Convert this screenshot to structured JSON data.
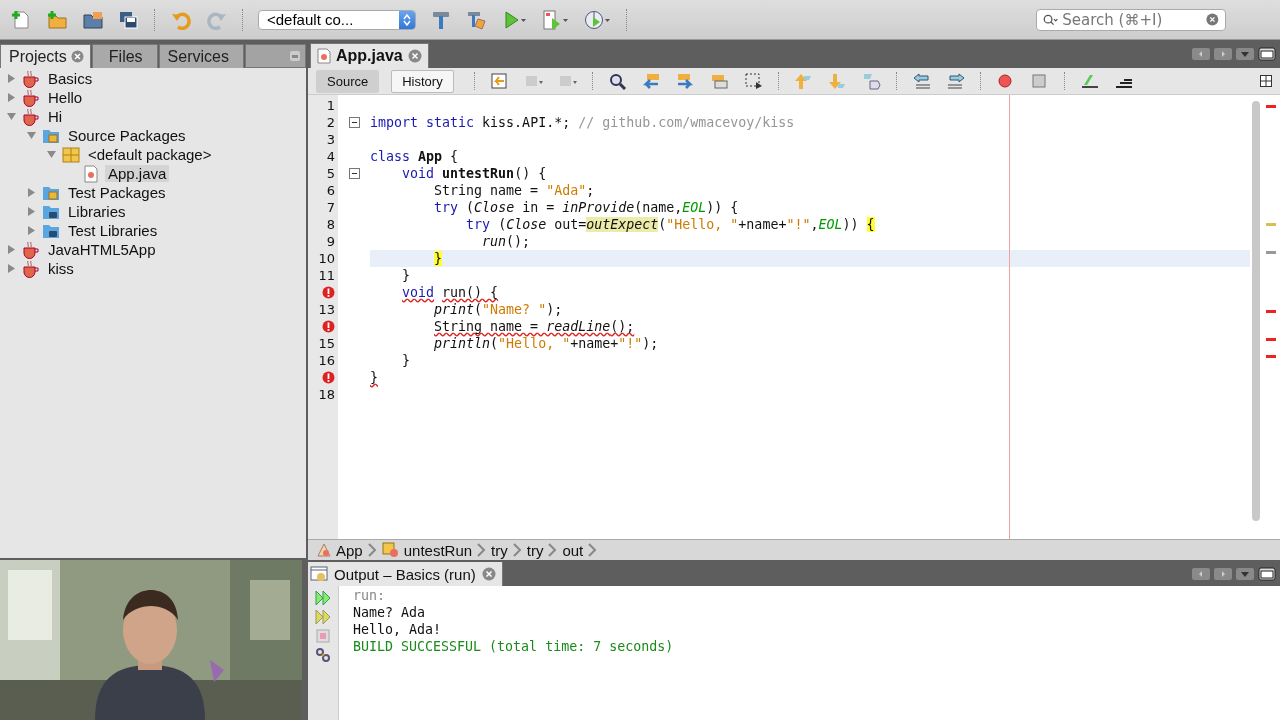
{
  "toolbar": {
    "config": {
      "value": "<default co..."
    },
    "search": {
      "placeholder": "Search (⌘+I)"
    }
  },
  "projects_panel": {
    "tabs": [
      {
        "label": "Projects",
        "selected": true,
        "closable": true
      },
      {
        "label": "Files",
        "selected": false,
        "closable": false
      },
      {
        "label": "Services",
        "selected": false,
        "closable": false
      }
    ],
    "tree": [
      {
        "label": "Basics",
        "kind": "project",
        "expanded": false,
        "selected": false
      },
      {
        "label": "Hello",
        "kind": "project",
        "expanded": false,
        "selected": false
      },
      {
        "label": "Hi",
        "kind": "project",
        "expanded": true,
        "selected": false,
        "children": [
          {
            "label": "Source Packages",
            "kind": "source-folder",
            "expanded": true,
            "selected": false,
            "children": [
              {
                "label": "<default package>",
                "kind": "package",
                "expanded": true,
                "selected": false,
                "children": [
                  {
                    "label": "App.java",
                    "kind": "file",
                    "selected": true
                  }
                ]
              }
            ]
          },
          {
            "label": "Test Packages",
            "kind": "source-folder",
            "expanded": false,
            "selected": false
          },
          {
            "label": "Libraries",
            "kind": "library-folder",
            "expanded": false,
            "selected": false
          },
          {
            "label": "Test Libraries",
            "kind": "library-folder",
            "expanded": false,
            "selected": false
          }
        ]
      },
      {
        "label": "JavaHTML5App",
        "kind": "project",
        "expanded": false,
        "selected": false
      },
      {
        "label": "kiss",
        "kind": "project",
        "expanded": false,
        "selected": false
      }
    ]
  },
  "editor": {
    "tabs": [
      {
        "label": "App.java",
        "selected": true
      }
    ],
    "views": [
      {
        "label": "Source",
        "selected": true
      },
      {
        "label": "History",
        "selected": false
      }
    ],
    "lines": [
      {
        "number": "1",
        "error": false,
        "fold": false,
        "current": false
      },
      {
        "number": "2",
        "error": false,
        "fold": true,
        "current": false,
        "tokens": [
          {
            "kind": "kw",
            "text": "import static"
          },
          {
            "kind": "plain",
            "text": " kiss.API.*; "
          },
          {
            "kind": "comment",
            "text": "// github.com/wmacevoy/kiss"
          }
        ]
      },
      {
        "number": "3",
        "error": false,
        "fold": false,
        "current": false
      },
      {
        "number": "4",
        "error": false,
        "fold": false,
        "current": false,
        "tokens": [
          {
            "kind": "kw",
            "text": "class"
          },
          {
            "kind": "bold",
            "text": " App"
          },
          {
            "kind": "plain",
            "text": " {"
          }
        ]
      },
      {
        "number": "5",
        "error": false,
        "fold": true,
        "current": false,
        "tokens": [
          {
            "kind": "kw",
            "text": "    void"
          },
          {
            "kind": "bold",
            "text": " untestRun"
          },
          {
            "kind": "plain",
            "text": "() {"
          }
        ]
      },
      {
        "number": "6",
        "error": false,
        "fold": false,
        "current": false,
        "tokens": [
          {
            "kind": "plain",
            "text": "        String name = "
          },
          {
            "kind": "str",
            "text": "\"Ada\""
          },
          {
            "kind": "plain",
            "text": ";"
          }
        ]
      },
      {
        "number": "7",
        "error": false,
        "fold": false,
        "current": false,
        "tokens": [
          {
            "kind": "kw",
            "text": "        try"
          },
          {
            "kind": "plain",
            "text": " ("
          },
          {
            "kind": "call",
            "text": "Close"
          },
          {
            "kind": "plain",
            "text": " in = "
          },
          {
            "kind": "call",
            "text": "inProvide"
          },
          {
            "kind": "plain",
            "text": "(name,"
          },
          {
            "kind": "const",
            "text": "EOL"
          },
          {
            "kind": "plain",
            "text": ")) {"
          }
        ]
      },
      {
        "number": "8",
        "error": false,
        "fold": false,
        "current": false,
        "tokens": [
          {
            "kind": "kw",
            "text": "            try"
          },
          {
            "kind": "plain",
            "text": " ("
          },
          {
            "kind": "call",
            "text": "Close"
          },
          {
            "kind": "plain",
            "text": " out="
          },
          {
            "kind": "hl",
            "text": "outExpect"
          },
          {
            "kind": "plain",
            "text": "("
          },
          {
            "kind": "str",
            "text": "\"Hello, \""
          },
          {
            "kind": "plain",
            "text": "+name+"
          },
          {
            "kind": "str",
            "text": "\"!\""
          },
          {
            "kind": "plain",
            "text": ","
          },
          {
            "kind": "const",
            "text": "EOL"
          },
          {
            "kind": "plain",
            "text": ")) "
          },
          {
            "kind": "mark",
            "text": "{"
          }
        ]
      },
      {
        "number": "9",
        "error": false,
        "fold": false,
        "current": false,
        "tokens": [
          {
            "kind": "call",
            "text": "              run"
          },
          {
            "kind": "plain",
            "text": "();"
          }
        ]
      },
      {
        "number": "10",
        "error": false,
        "fold": false,
        "current": true,
        "tokens": [
          {
            "kind": "mark",
            "text": "        }"
          }
        ]
      },
      {
        "number": "11",
        "error": false,
        "fold": false,
        "current": false,
        "tokens": [
          {
            "kind": "plain",
            "text": "    }"
          }
        ]
      },
      {
        "error": true,
        "fold": false,
        "current": false,
        "tokens": [
          {
            "kind": "kw",
            "text": "    void"
          },
          {
            "kind": "plain",
            "text": " run() {"
          }
        ]
      },
      {
        "number": "13",
        "error": false,
        "fold": false,
        "current": false,
        "tokens": [
          {
            "kind": "call",
            "text": "        print"
          },
          {
            "kind": "plain",
            "text": "("
          },
          {
            "kind": "str",
            "text": "\"Name? \""
          },
          {
            "kind": "plain",
            "text": ");"
          }
        ]
      },
      {
        "error": true,
        "fold": false,
        "current": false,
        "tokens": [
          {
            "kind": "plain",
            "text": "        String name = "
          },
          {
            "kind": "call",
            "text": "readLine"
          },
          {
            "kind": "plain",
            "text": "();"
          }
        ]
      },
      {
        "number": "15",
        "error": false,
        "fold": false,
        "current": false,
        "tokens": [
          {
            "kind": "call",
            "text": "        println"
          },
          {
            "kind": "plain",
            "text": "("
          },
          {
            "kind": "str",
            "text": "\"Hello, \""
          },
          {
            "kind": "plain",
            "text": "+name+"
          },
          {
            "kind": "str",
            "text": "\"!\""
          },
          {
            "kind": "plain",
            "text": ");"
          }
        ]
      },
      {
        "number": "16",
        "error": false,
        "fold": false,
        "current": false,
        "tokens": [
          {
            "kind": "plain",
            "text": "    }"
          }
        ]
      },
      {
        "error": true,
        "fold": false,
        "current": false,
        "tokens": [
          {
            "kind": "plain",
            "text": "}"
          }
        ]
      },
      {
        "number": "18",
        "error": false,
        "fold": false,
        "current": false
      }
    ],
    "breadcrumb": [
      {
        "label": "App",
        "kind": "class"
      },
      {
        "label": "untestRun",
        "kind": "method"
      },
      {
        "label": "try",
        "kind": "plain"
      },
      {
        "label": "try",
        "kind": "plain"
      },
      {
        "label": "out",
        "kind": "plain"
      }
    ]
  },
  "output": {
    "tab": {
      "label": "Output – Basics (run)",
      "selected": true
    },
    "lines": [
      {
        "kind": "meta",
        "text": "run:"
      },
      {
        "kind": "plain",
        "text": "Name? Ada"
      },
      {
        "kind": "plain",
        "text": "Hello, Ada!"
      },
      {
        "kind": "success",
        "text": "BUILD SUCCESSFUL (total time: 7 seconds)"
      }
    ]
  }
}
